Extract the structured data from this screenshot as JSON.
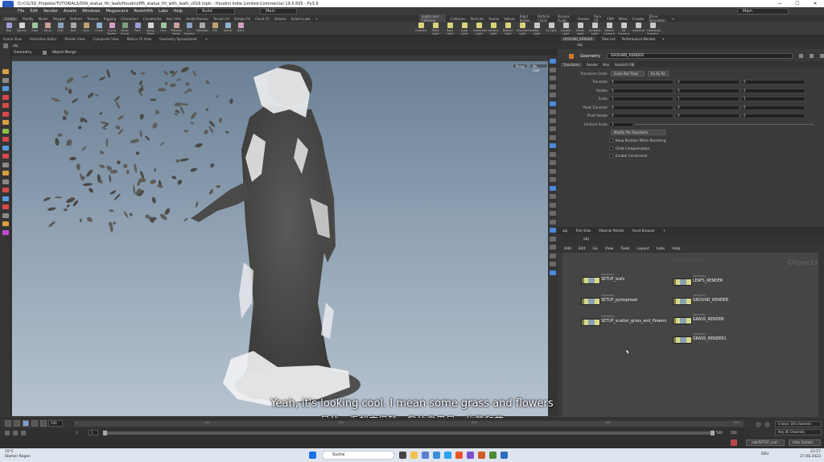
{
  "window": {
    "title": "D:/CG/3D_Projekte/TUTORIALS/009_statue_fill_leafs/Houdini/M5_statue_fill_with_leafs_v016.hiplc - Houdini Indie Limited-Commercial 19.5.605 - Py3.9",
    "controls": [
      "—",
      "☐",
      "✕"
    ]
  },
  "menubar": {
    "items": [
      "File",
      "Edit",
      "Render",
      "Assets",
      "Windows",
      "Megascans",
      "RedshiftA",
      "Labs",
      "Help"
    ],
    "desktop": "Build",
    "desktop2": "Main",
    "user": "Main"
  },
  "shelf_tabs": {
    "left": [
      "Create",
      "Modify",
      "Model",
      "Polygon",
      "Deform",
      "Texture",
      "Rigging",
      "Characters",
      "Constraints",
      "Hair Utils",
      "Guide Process",
      "Terrain FX",
      "Simple FX",
      "Cloud FX",
      "Volume",
      "Solaris Labs",
      "+"
    ],
    "right": [
      "Lights and Cameras",
      "Collisions",
      "Particles",
      "Grains",
      "Vellum",
      "Rigid Bodies",
      "Particle Fluids",
      "Viscous Fluids",
      "Oceans",
      "Pyro FX",
      "FEM",
      "Wires",
      "Crowds",
      "Drive Simulation",
      "+"
    ]
  },
  "shelf_tools_left": [
    "Box",
    "Sphere",
    "Tube",
    "Torus",
    "Grid",
    "Null",
    "Line",
    "Circle",
    "Curve Bezier",
    "Draw Curve",
    "Path",
    "Spray Paint",
    "Font",
    "Platonic Solids",
    "L-System",
    "Metaball",
    "File",
    "Spiral",
    "Helix"
  ],
  "shelf_tools_right": [
    "Camera",
    "Point Light",
    "Spot Light",
    "Area Light",
    "Geometry Light",
    "Volume Light",
    "Distant Light",
    "Environment Light",
    "Sky Light",
    "GI Light",
    "Caustic Light",
    "Portal Light",
    "Ambient Light",
    "Stereo Camera",
    "VR Camera",
    "Switcher",
    "Gamepad Camera"
  ],
  "viewer_tabs": [
    "Scene View",
    "Animation Editor",
    "Render View",
    "Composite View",
    "Motion FX View",
    "Geometry Spreadsheet",
    "+"
  ],
  "viewer": {
    "path_root": "obj",
    "context": "Geometry",
    "state": "Object Merge",
    "persp": "Persp",
    "cam": "No cam"
  },
  "subtitles": {
    "en": "Yeah, it's looking cool. I mean some grass and flowers",
    "zh": "是的，看起来很酷。我的意思是一些草和花"
  },
  "timeline": {
    "current_frame": "1",
    "end_frame": "500",
    "start": "1",
    "range_end_a": "500",
    "range_end_b": "500",
    "ticks": [
      "1",
      "100",
      "200",
      "300",
      "400",
      "500"
    ],
    "keys_channels": "0 keys, 0/0 channels",
    "key_all": "Key All Channels"
  },
  "status": {
    "node_path": "/obj/SETUP_scat...",
    "auto_update": "Auto Update"
  },
  "param_tabs": [
    "GROUND_RENDER",
    "Take List",
    "Performance Monitor",
    "+"
  ],
  "param_path": "obj",
  "param_header": {
    "type": "Geometry",
    "name": "GROUND_RENDER"
  },
  "param_subtabs": [
    "Transform",
    "Render",
    "Misc",
    "Redshift OBJ"
  ],
  "params": {
    "transform_order_label": "Transform Order",
    "transform_order_value": "Scale Rot Trans",
    "rot_order_value": "Rx Ry Rz",
    "rows": [
      {
        "label": "Translate",
        "x": "0",
        "y": "0",
        "z": "0"
      },
      {
        "label": "Rotate",
        "x": "0",
        "y": "0",
        "z": "0"
      },
      {
        "label": "Scale",
        "x": "1",
        "y": "1",
        "z": "1"
      },
      {
        "label": "Pivot Translate",
        "x": "0",
        "y": "0",
        "z": "0"
      },
      {
        "label": "Pivot Rotate",
        "x": "0",
        "y": "0",
        "z": "0"
      }
    ],
    "uniform_scale_label": "Uniform Scale",
    "uniform_scale_value": "1",
    "modify_pre_transform": "Modify Pre-Transform",
    "checks": [
      "Keep Position When Parenting",
      "Child Compensation",
      "Enable Constraints"
    ]
  },
  "network_tabs": [
    "obj",
    "Tree View",
    "Material Palette",
    "Asset Browser",
    "+"
  ],
  "network_path": "obj",
  "network_menu": [
    "Add",
    "Edit",
    "Go",
    "View",
    "Tools",
    "Layout",
    "Labs",
    "Help"
  ],
  "network": {
    "context_label": "Indie Edition",
    "watermark": "Objects",
    "nodes_left": [
      {
        "type": "Geometry",
        "name": "SETUP_leafs"
      },
      {
        "type": "Geometry",
        "name": "SETUP_pyrospread"
      },
      {
        "type": "Geometry",
        "name": "SETUP_scatter_grass_and_flowers"
      }
    ],
    "nodes_right": [
      {
        "type": "Geometry",
        "name": "LEAFS_RENDER"
      },
      {
        "type": "Geometry",
        "name": "GROUND_RENDER"
      },
      {
        "type": "Geometry",
        "name": "GRASS_RENDER"
      },
      {
        "type": "Geometry",
        "name": "GRASS_RENDER1"
      }
    ]
  },
  "taskbar": {
    "temp": "15°C",
    "weather": "Starker Regen",
    "search": "Suche",
    "lang": "DEU",
    "time": "21:57",
    "date": "27.08.2023"
  },
  "colors": {
    "node_body": "#d5d98a",
    "viewport_top": "#6b8095",
    "viewport_bottom": "#b7c3cf",
    "taskbar": "#dfe5ee"
  }
}
